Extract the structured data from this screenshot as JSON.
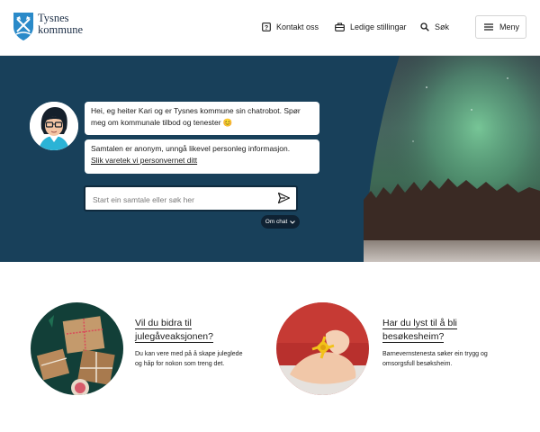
{
  "header": {
    "brand_line1": "Tysnes",
    "brand_line2": "kommune",
    "nav": {
      "contact": "Kontakt oss",
      "jobs": "Ledige stillingar",
      "search": "Søk",
      "menu": "Meny"
    }
  },
  "hero": {
    "messages": {
      "greeting": "Hei, eg heiter Kari og er Tysnes kommune sin chatrobot. Spør meg om kommunale tilbod og tenester 😊",
      "privacy_text": "Samtalen er anonym, unngå likevel personleg informasjon.",
      "privacy_link": "Slik varetek vi personvernet ditt"
    },
    "chat_input": {
      "placeholder": "Start ein samtale eller søk her"
    },
    "om_chat_label": "Om chat"
  },
  "cards": [
    {
      "title_line1": "Vil du bidra til",
      "title_line2": "julegåveaksjonen?",
      "description": "Du kan vere med på å skape juleglede og håp for nokon som treng det."
    },
    {
      "title_line1": "Har du lyst til å bli",
      "title_line2": "besøkesheim?",
      "description": "Barnevernstenesta søker ein trygg og omsorgsfull besøksheim."
    }
  ],
  "colors": {
    "hero_bg": "#18405a",
    "brand_text": "#1d2f47",
    "shield_blue": "#2a8ac9"
  }
}
